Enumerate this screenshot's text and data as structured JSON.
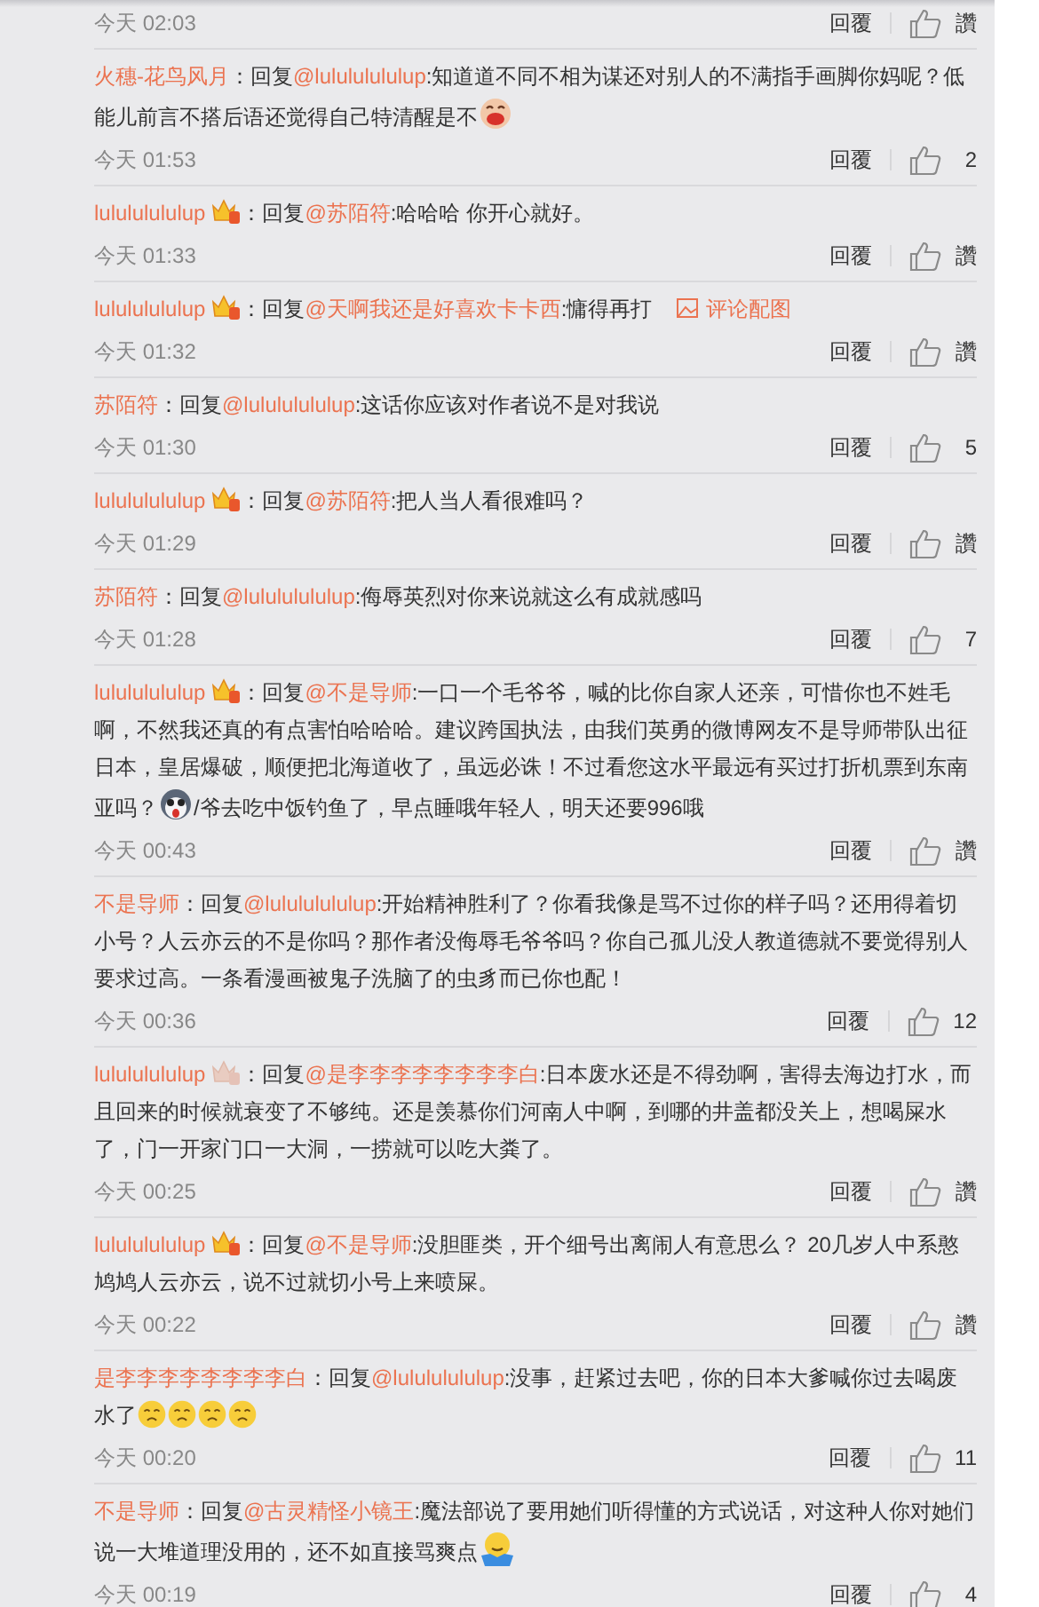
{
  "comments": [
    {
      "time": "今天 02:03",
      "reply": "回覆",
      "likes": "讚"
    },
    {
      "author": "火穗-花鸟风月",
      "vip": false,
      "sep": "：",
      "reply_word": "回复",
      "mention": "@lulululululup",
      "content": [
        {
          "kind": "text",
          "text": ":知道道不同不相为谋还对别人的不满指手画脚你妈呢？低能儿前言不搭后语还觉得自己特清醒是不"
        },
        {
          "kind": "laugh"
        }
      ],
      "time": "今天 01:53",
      "reply": "回覆",
      "likes": "2"
    },
    {
      "author": "lulululululup",
      "vip": true,
      "vip_dimmed": false,
      "sep": "：",
      "reply_word": "回复",
      "mention": "@苏陌符",
      "content": [
        {
          "kind": "text",
          "text": ":哈哈哈 你开心就好。"
        }
      ],
      "time": "今天 01:33",
      "reply": "回覆",
      "likes": "讚"
    },
    {
      "author": "lulululululup",
      "vip": true,
      "vip_dimmed": false,
      "sep": "：",
      "reply_word": "回复",
      "mention": "@天啊我还是好喜欢卡卡西",
      "content": [
        {
          "kind": "text",
          "text": ":慵得再打"
        }
      ],
      "image_link": "评论配图",
      "time": "今天 01:32",
      "reply": "回覆",
      "likes": "讚"
    },
    {
      "author": "苏陌符",
      "vip": false,
      "sep": "：",
      "reply_word": "回复",
      "mention": "@lulululululup",
      "content": [
        {
          "kind": "text",
          "text": ":这话你应该对作者说不是对我说"
        }
      ],
      "time": "今天 01:30",
      "reply": "回覆",
      "likes": "5"
    },
    {
      "author": "lulululululup",
      "vip": true,
      "vip_dimmed": false,
      "sep": "：",
      "reply_word": "回复",
      "mention": "@苏陌符",
      "content": [
        {
          "kind": "text",
          "text": ":把人当人看很难吗？"
        }
      ],
      "time": "今天 01:29",
      "reply": "回覆",
      "likes": "讚"
    },
    {
      "author": "苏陌符",
      "vip": false,
      "sep": "：",
      "reply_word": "回复",
      "mention": "@lulululululup",
      "content": [
        {
          "kind": "text",
          "text": ":侮辱英烈对你来说就这么有成就感吗"
        }
      ],
      "time": "今天 01:28",
      "reply": "回覆",
      "likes": "7"
    },
    {
      "author": "lulululululup",
      "vip": true,
      "vip_dimmed": false,
      "sep": "：",
      "reply_word": "回复",
      "mention": "@不是导师",
      "content": [
        {
          "kind": "text",
          "text": ":一口一个毛爷爷，喊的比你自家人还亲，可惜你也不姓毛啊，不然我还真的有点害怕哈哈哈。建议跨国执法，由我们英勇的微博网友不是导师带队出征日本，皇居爆破，顺便把北海道收了，虽远必诛！不过看您这水平最远有买过打折机票到东南亚吗？"
        },
        {
          "kind": "dog"
        },
        {
          "kind": "text",
          "text": "/爷去吃中饭钓鱼了，早点睡哦年轻人，明天还要996哦"
        }
      ],
      "time": "今天 00:43",
      "reply": "回覆",
      "likes": "讚"
    },
    {
      "author": "不是导师",
      "vip": false,
      "sep": "：",
      "reply_word": "回复",
      "mention": "@lulululululup",
      "content": [
        {
          "kind": "text",
          "text": ":开始精神胜利了？你看我像是骂不过你的样子吗？还用得着切小号？人云亦云的不是你吗？那作者没侮辱毛爷爷吗？你自己孤儿没人教道德就不要觉得别人要求过高。一条看漫画被鬼子洗脑了的虫豸而已你也配！"
        }
      ],
      "time": "今天 00:36",
      "reply": "回覆",
      "likes": "12"
    },
    {
      "author": "lulululululup",
      "vip": true,
      "vip_dimmed": true,
      "sep": "：",
      "reply_word": "回复",
      "mention": "@是李李李李李李李李白",
      "content": [
        {
          "kind": "text",
          "text": ":日本废水还是不得劲啊，害得去海边打水，而且回来的时候就衰变了不够纯。还是羡慕你们河南人中啊，到哪的井盖都没关上，想喝屎水了，门一开家门口一大洞，一捞就可以吃大粪了。"
        }
      ],
      "time": "今天 00:25",
      "reply": "回覆",
      "likes": "讚"
    },
    {
      "author": "lulululululup",
      "vip": true,
      "vip_dimmed": false,
      "sep": "：",
      "reply_word": "回复",
      "mention": "@不是导师",
      "content": [
        {
          "kind": "text",
          "text": ":没胆匪类，开个细号出离闹人有意思么？ 20几岁人中系憨鸠鸠人云亦云，说不过就切小号上来喷屎。"
        }
      ],
      "time": "今天 00:22",
      "reply": "回覆",
      "likes": "讚"
    },
    {
      "author": "是李李李李李李李李白",
      "vip": false,
      "sep": "：",
      "reply_word": "回复",
      "mention": "@lulululululup",
      "content": [
        {
          "kind": "text",
          "text": ":没事，赶紧过去吧，你的日本大爹喊你过去喝废水了"
        },
        {
          "kind": "sad"
        },
        {
          "kind": "sad"
        },
        {
          "kind": "sad"
        },
        {
          "kind": "sad"
        }
      ],
      "time": "今天 00:20",
      "reply": "回覆",
      "likes": "11"
    },
    {
      "author": "不是导师",
      "vip": false,
      "sep": "：",
      "reply_word": "回复",
      "mention": "@古灵精怪小镜王",
      "content": [
        {
          "kind": "text",
          "text": ":魔法部说了要用她们听得懂的方式说话，对这种人你对她们说一大堆道理没用的，还不如直接骂爽点"
        },
        {
          "kind": "shrug"
        }
      ],
      "time": "今天 00:19",
      "reply": "回覆",
      "likes": "4"
    }
  ]
}
